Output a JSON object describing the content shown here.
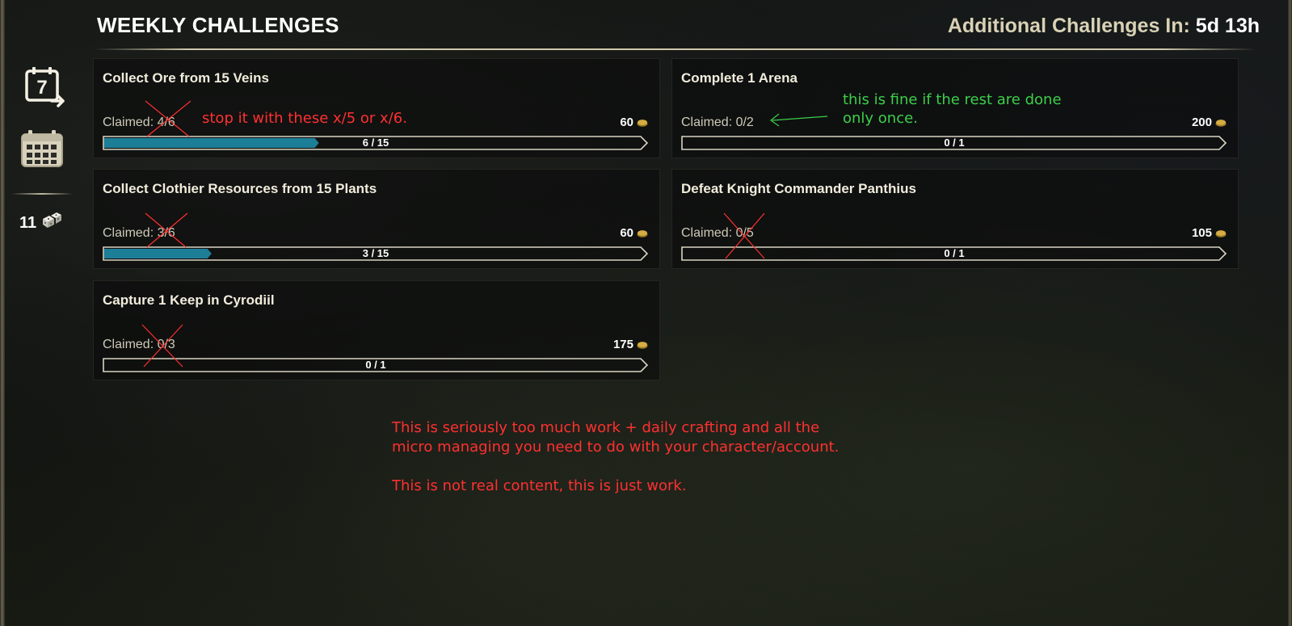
{
  "header": {
    "title": "WEEKLY CHALLENGES",
    "timer_label": "Additional Challenges In:",
    "timer_value": "5d 13h"
  },
  "sidebar": {
    "weekly_icon": "calendar-7-arrow-icon",
    "weekly_icon_digit": "7",
    "calendar_icon": "calendar-grid-icon",
    "currency_amount": "11",
    "currency_icon": "seals-dice-icon"
  },
  "challenges": [
    {
      "title": "Collect Ore from 15 Veins",
      "claimed": "Claimed: 4/6",
      "reward": "60",
      "progress_text": "6 / 15",
      "progress": 0.4
    },
    {
      "title": "Complete 1 Arena",
      "claimed": "Claimed: 0/2",
      "reward": "200",
      "progress_text": "0 / 1",
      "progress": 0
    },
    {
      "title": "Collect Clothier Resources from 15 Plants",
      "claimed": "Claimed: 3/6",
      "reward": "60",
      "progress_text": "3 / 15",
      "progress": 0.2
    },
    {
      "title": "Defeat Knight Commander Panthius",
      "claimed": "Claimed: 0/5",
      "reward": "105",
      "progress_text": "0 / 1",
      "progress": 0
    },
    {
      "title": "Capture 1 Keep in Cyrodiil",
      "claimed": "Claimed: 0/3",
      "reward": "175",
      "progress_text": "0 / 1",
      "progress": 0
    }
  ],
  "annotations": {
    "note_1": "stop it with these x/5 or x/6.",
    "note_2_line1": "this is fine if the rest are done",
    "note_2_line2": "only once.",
    "note_3_line1": "This is seriously too much work + daily crafting and all the",
    "note_3_line2": "micro managing you need to do with your character/account.",
    "note_4": "This is not real content, this is just work.",
    "colors": {
      "red": "#ff3030",
      "green": "#3ccf4a"
    }
  },
  "colors": {
    "progress_fill": "#1d7e98",
    "gold": "#c9a23a"
  }
}
